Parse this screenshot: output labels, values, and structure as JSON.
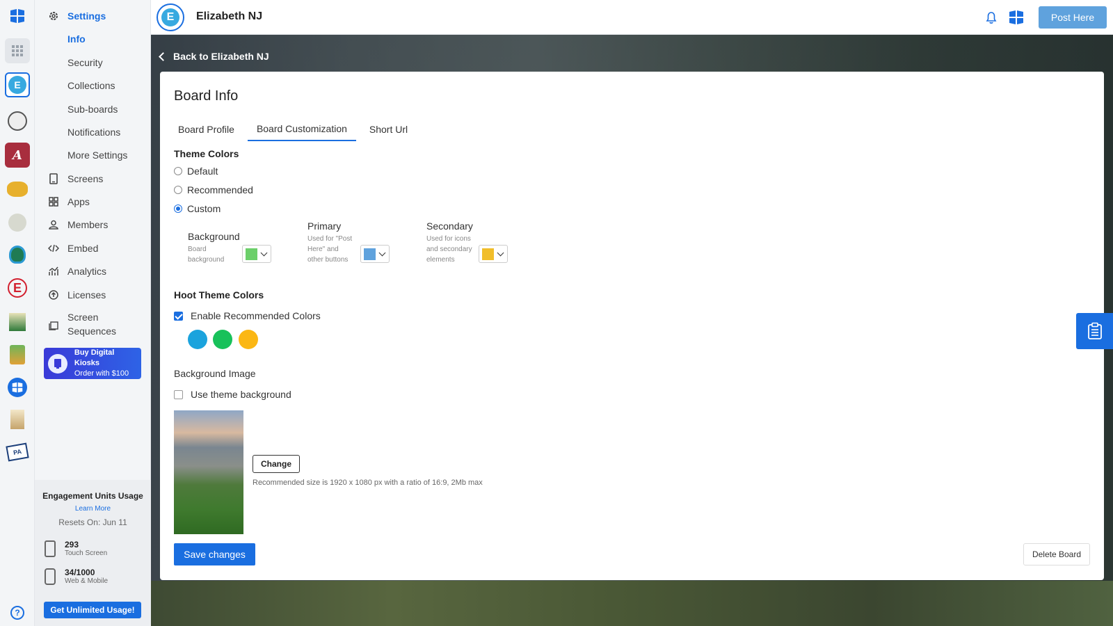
{
  "nav": {
    "settings_label": "Settings",
    "sub_items": [
      "Info",
      "Security",
      "Collections",
      "Sub-boards",
      "Notifications",
      "More Settings"
    ],
    "items": [
      {
        "label": "Screens",
        "icon": "tablet-icon"
      },
      {
        "label": "Apps",
        "icon": "grid-icon"
      },
      {
        "label": "Members",
        "icon": "user-icon"
      },
      {
        "label": "Embed",
        "icon": "code-icon"
      },
      {
        "label": "Analytics",
        "icon": "chart-icon"
      },
      {
        "label": "Licenses",
        "icon": "upload-circle-icon"
      },
      {
        "label": "Screen Sequences",
        "icon": "screens-icon"
      }
    ],
    "promo": {
      "title": "Buy Digital Kiosks",
      "subtitle": "Order with $100"
    },
    "usage": {
      "title": "Engagement Units Usage",
      "learn_more": "Learn More",
      "reset": "Resets On: Jun 11",
      "touch": {
        "value": "293",
        "label": "Touch Screen"
      },
      "web": {
        "value": "34/1000",
        "label": "Web & Mobile"
      },
      "cta": "Get Unlimited Usage!"
    }
  },
  "rail": {
    "help": "?"
  },
  "topbar": {
    "board_name": "Elizabeth NJ",
    "post_label": "Post Here"
  },
  "back_label": "Back to Elizabeth NJ",
  "card": {
    "title": "Board Info",
    "tabs": [
      "Board Profile",
      "Board Customization",
      "Short Url"
    ],
    "theme": {
      "title": "Theme Colors",
      "options": [
        "Default",
        "Recommended",
        "Custom"
      ],
      "selected": "Custom",
      "blocks": [
        {
          "title": "Background",
          "sub": "Board background",
          "color": "#6ccf6a"
        },
        {
          "title": "Primary",
          "sub": "Used for \"Post Here\" and other buttons",
          "color": "#5fa2dd"
        },
        {
          "title": "Secondary",
          "sub": "Used for icons and secondary elements",
          "color": "#f1be2b"
        }
      ]
    },
    "hoot": {
      "title": "Hoot Theme Colors",
      "enable_label": "Enable Recommended Colors",
      "colors": [
        "#1ba3dd",
        "#18c15a",
        "#fbb714"
      ]
    },
    "bg_image": {
      "title": "Background Image",
      "use_theme_label": "Use theme background",
      "change_label": "Change",
      "recommendation": "Recommended size is 1920 x 1080 px with a ratio of 16:9, 2Mb max"
    },
    "save_label": "Save changes",
    "delete_label": "Delete Board"
  }
}
